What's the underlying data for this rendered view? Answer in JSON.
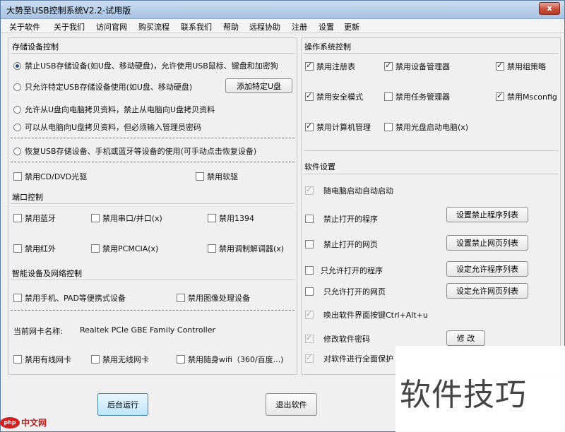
{
  "window": {
    "title": "大势至USB控制系统V2.2-试用版",
    "close_label": "x"
  },
  "menu": [
    "关于软件",
    "关于我们",
    "访问官网",
    "购买流程",
    "联系我们",
    "帮助",
    "远程协助",
    "注册",
    "设置",
    "更新"
  ],
  "storage": {
    "title": "存储设备控制",
    "radios": [
      "禁止USB存储设备(如U盘、移动硬盘)，允许使用USB鼠标、键盘和加密狗",
      "只允许特定USB存储设备使用(如U盘、移动硬盘)",
      "允许从U盘向电脑拷贝资料，禁止从电脑向U盘拷贝资料",
      "可以从电脑向U盘拷贝资料，但必须输入管理员密码",
      "恢复USB存储设备、手机或蓝牙等设备的使用(可手动点击恢复设备)"
    ],
    "selected_index": 0,
    "add_button": "添加特定U盘",
    "cd_label": "禁用CD/DVD光驱",
    "floppy_label": "禁用软驱"
  },
  "port": {
    "title": "端口控制",
    "items": [
      "禁用蓝牙",
      "禁用串口/并口(x)",
      "禁用1394",
      "禁用红外",
      "禁用PCMCIA(x)",
      "禁用调制解调器(x)"
    ]
  },
  "smart": {
    "title": "智能设备及网络控制",
    "items": [
      "禁用手机、PAD等便携式设备",
      "禁用图像处理设备"
    ],
    "nic_label": "当前网卡名称:",
    "nic_value": "Realtek PCIe GBE Family Controller",
    "net_items": [
      "禁用有线网卡",
      "禁用无线网卡",
      "禁用随身wifi（360/百度...)"
    ]
  },
  "os": {
    "title": "操作系统控制",
    "items": [
      {
        "label": "禁用注册表",
        "checked": true
      },
      {
        "label": "禁用设备管理器",
        "checked": true
      },
      {
        "label": "禁用组策略",
        "checked": true
      },
      {
        "label": "禁用安全模式",
        "checked": true
      },
      {
        "label": "禁用任务管理器",
        "checked": false
      },
      {
        "label": "禁用Msconfig",
        "checked": true
      },
      {
        "label": "禁用计算机管理",
        "checked": true
      },
      {
        "label": "禁用光盘启动电脑(x)",
        "checked": false
      }
    ]
  },
  "software": {
    "title": "软件设置",
    "items": [
      {
        "label": "随电脑启动自动启动",
        "state": "disabled"
      },
      {
        "label": "禁止打开的程序",
        "state": "off",
        "button": "设置禁止程序列表"
      },
      {
        "label": "禁止打开的网页",
        "state": "off",
        "button": "设置禁止网页列表"
      },
      {
        "label": "只允许打开的程序",
        "state": "off",
        "button": "设定允许程序列表"
      },
      {
        "label": "只允许打开的网页",
        "state": "off",
        "button": "设定允许网页列表"
      },
      {
        "label": "唤出软件界面按键Ctrl+Alt+u",
        "state": "disabled"
      },
      {
        "label": "修改软件密码",
        "state": "disabled",
        "button": "修 改"
      },
      {
        "label": "对软件进行全面保护",
        "state": "disabled"
      }
    ]
  },
  "buttons": {
    "run_background": "后台运行",
    "exit": "退出软件"
  },
  "watermark": {
    "text": "软件技巧",
    "logo_php": "php",
    "logo_cn": "中文网"
  }
}
